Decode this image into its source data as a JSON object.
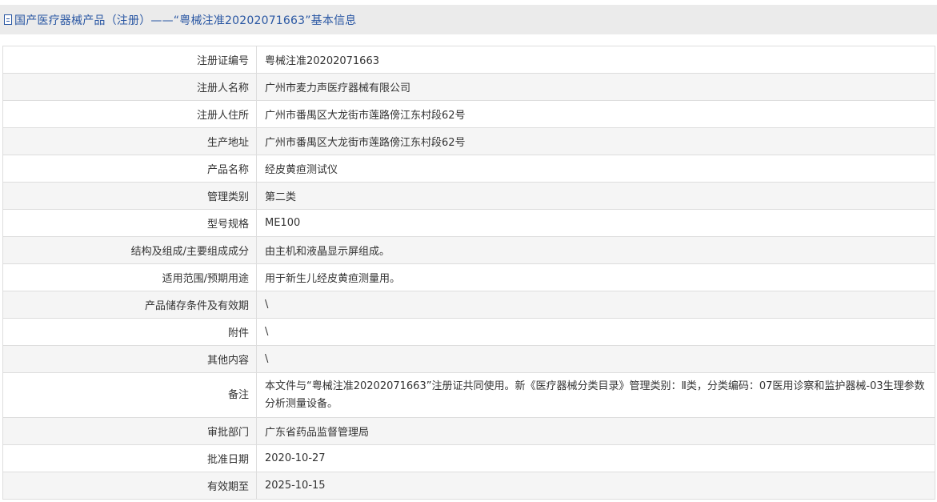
{
  "header": {
    "icon": "document-icon",
    "title": "国产医疗器械产品（注册）——“粤械注准20202071663”基本信息"
  },
  "rows": [
    {
      "label": "注册证编号",
      "value": "粤械注准20202071663"
    },
    {
      "label": "注册人名称",
      "value": "广州市麦力声医疗器械有限公司"
    },
    {
      "label": "注册人住所",
      "value": "广州市番禺区大龙街市莲路傍江东村段62号"
    },
    {
      "label": "生产地址",
      "value": "广州市番禺区大龙街市莲路傍江东村段62号"
    },
    {
      "label": "产品名称",
      "value": "经皮黄疸测试仪"
    },
    {
      "label": "管理类别",
      "value": "第二类"
    },
    {
      "label": "型号规格",
      "value": "ME100"
    },
    {
      "label": "结构及组成/主要组成成分",
      "value": "由主机和液晶显示屏组成。"
    },
    {
      "label": "适用范围/预期用途",
      "value": "用于新生儿经皮黄疸测量用。"
    },
    {
      "label": "产品储存条件及有效期",
      "value": "\\"
    },
    {
      "label": "附件",
      "value": "\\"
    },
    {
      "label": "其他内容",
      "value": "\\"
    },
    {
      "label": "备注",
      "value": "本文件与“粤械注准20202071663”注册证共同使用。新《医疗器械分类目录》管理类别：Ⅱ类，分类编码：07医用诊察和监护器械-03生理参数分析测量设备。"
    },
    {
      "label": "审批部门",
      "value": "广东省药品监督管理局"
    },
    {
      "label": "批准日期",
      "value": "2020-10-27"
    },
    {
      "label": "有效期至",
      "value": "2025-10-15"
    }
  ]
}
